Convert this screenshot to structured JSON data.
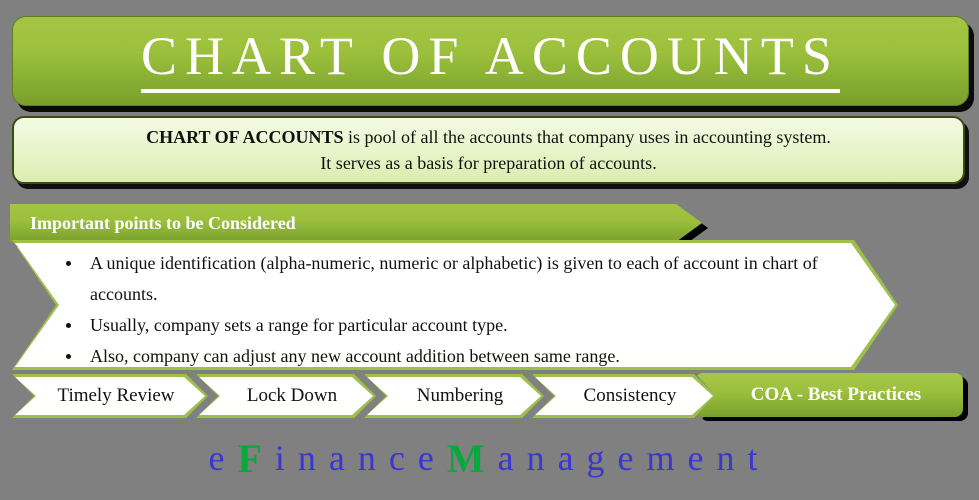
{
  "theme": {
    "background": "#808080",
    "green_light": "#a4c544",
    "green_dark": "#7b9f2d",
    "panel_tint": "#eaf5cd",
    "text_dark": "#111111",
    "text_light": "#ffffff",
    "logo_blue": "#3a36d2",
    "logo_green": "#0aa83c"
  },
  "header": {
    "title": "CHART OF ACCOUNTS"
  },
  "definition": {
    "line1_bold": "CHART OF ACCOUNTS",
    "line1_rest": " is pool of all the accounts that company uses in accounting system.",
    "line2": "It serves as a basis for preparation of accounts."
  },
  "points_section": {
    "banner_label": "Important points to be Considered",
    "bullets": [
      "A unique identification (alpha-numeric, numeric or alphabetic) is given to each of account in chart of accounts.",
      "Usually, company sets a range for particular account type.",
      "Also, company can adjust any new account addition between same range."
    ]
  },
  "practices_row": {
    "items": [
      {
        "label": "Timely Review"
      },
      {
        "label": "Lock Down"
      },
      {
        "label": "Numbering"
      },
      {
        "label": "Consistency"
      }
    ],
    "final_tab": "COA - Best Practices"
  },
  "footer": {
    "logo_parts": [
      {
        "text": "e",
        "style": "blue"
      },
      {
        "text": "F",
        "style": "green"
      },
      {
        "text": "inance",
        "style": "blue"
      },
      {
        "text": "M",
        "style": "green"
      },
      {
        "text": "anagement",
        "style": "blue"
      }
    ]
  }
}
